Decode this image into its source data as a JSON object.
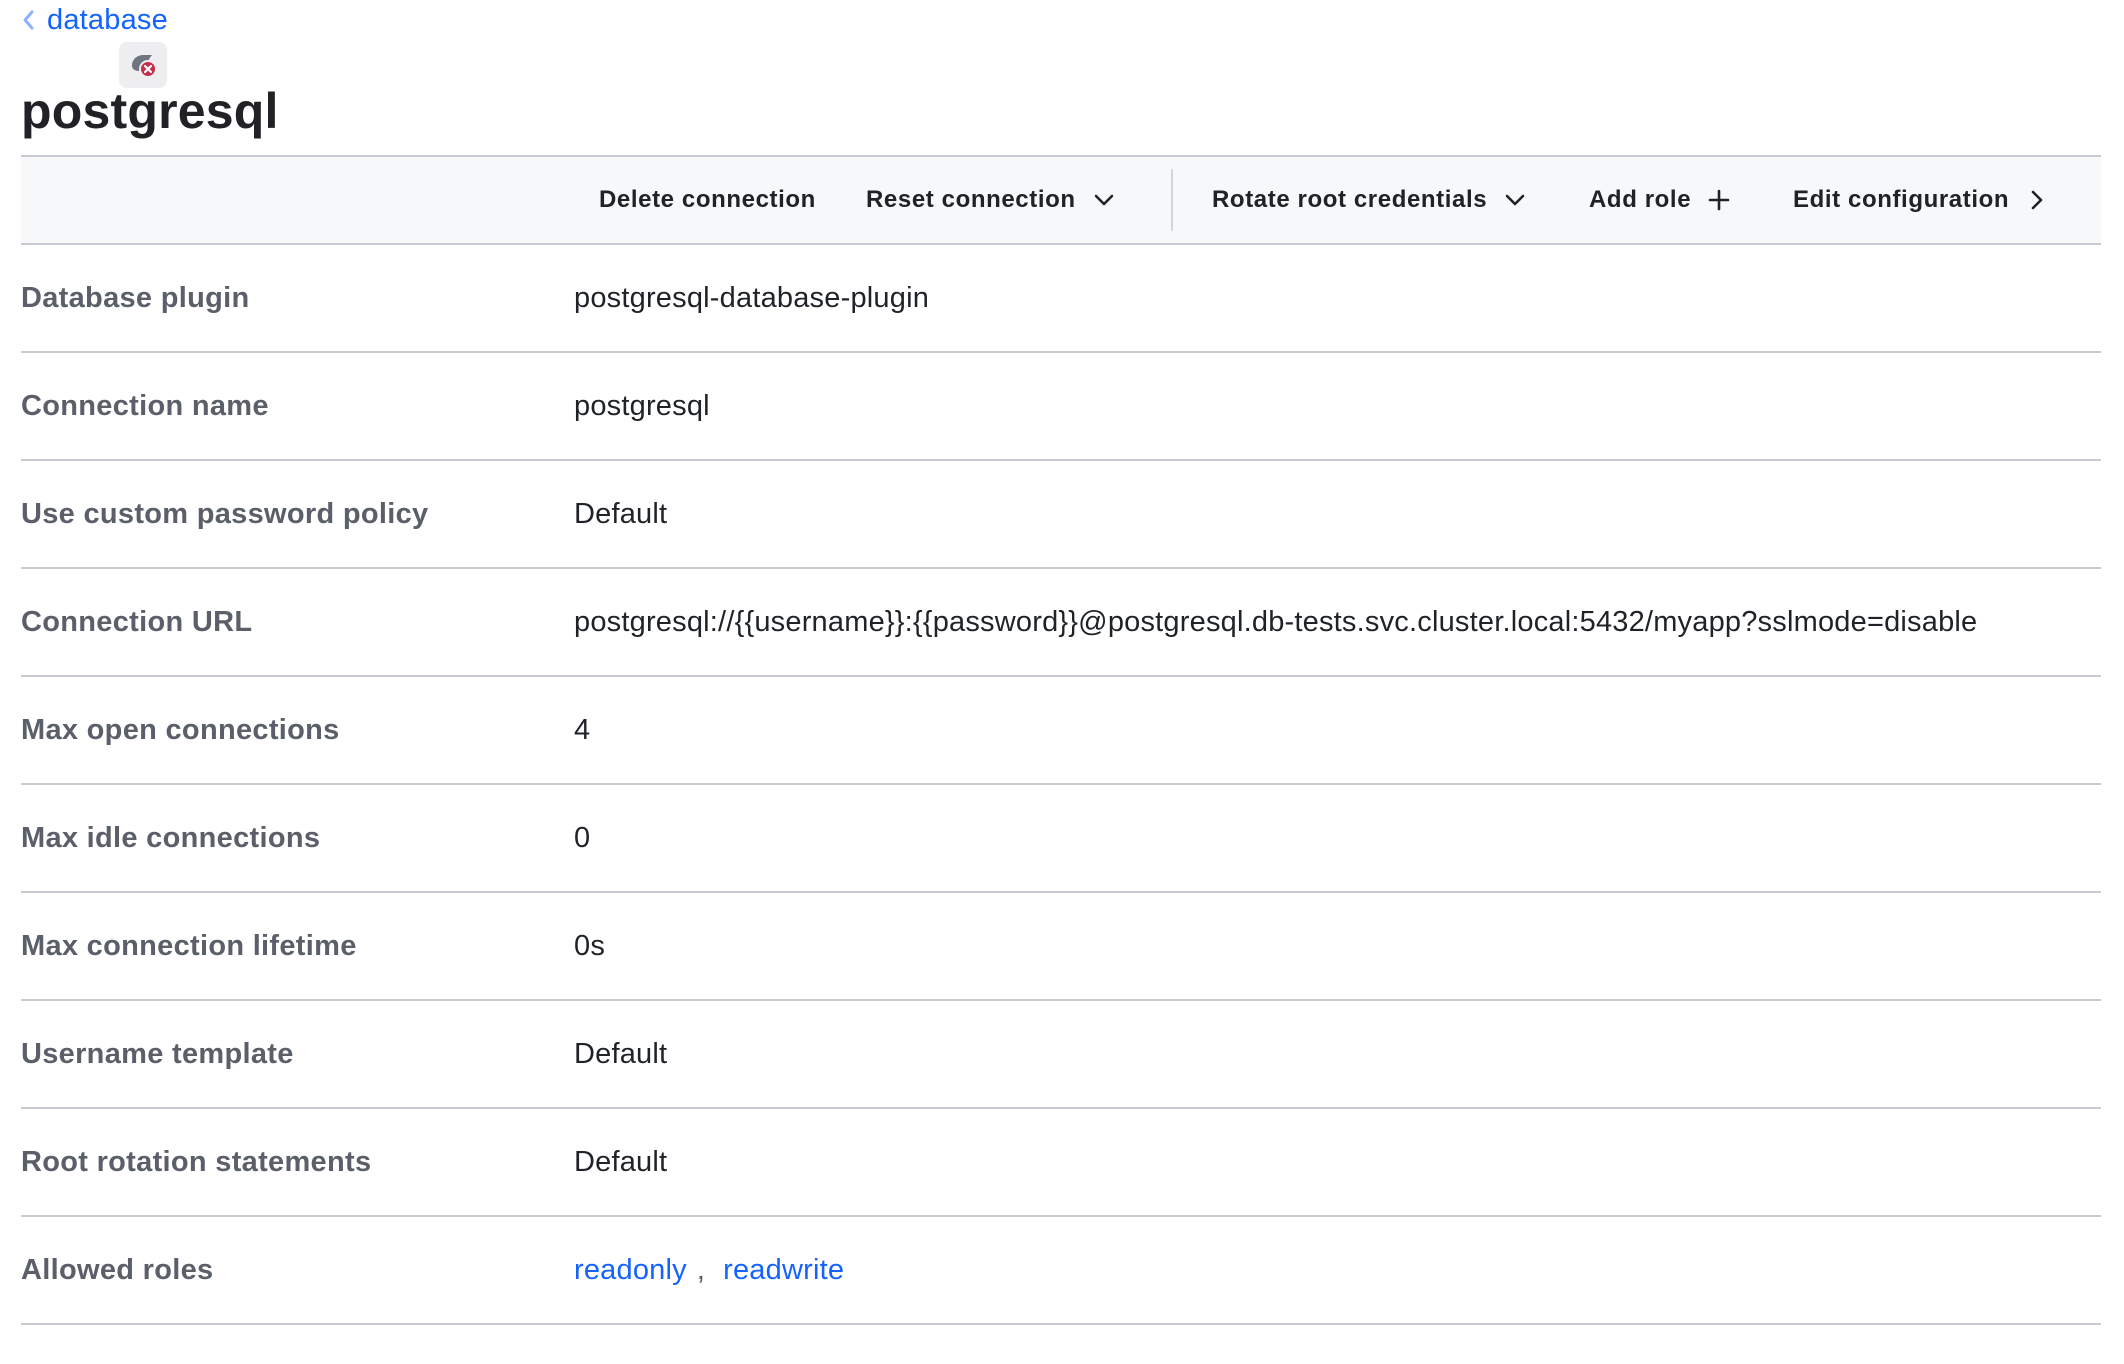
{
  "breadcrumb": {
    "label": "database",
    "icon": "chevron-left-icon"
  },
  "header": {
    "status_icon": "database-error-icon",
    "title": "postgresql"
  },
  "toolbar": {
    "delete_label": "Delete connection",
    "reset_label": "Reset connection",
    "rotate_label": "Rotate root credentials",
    "add_role_label": "Add role",
    "edit_label": "Edit configuration"
  },
  "details": [
    {
      "label": "Database plugin",
      "value": "postgresql-database-plugin"
    },
    {
      "label": "Connection name",
      "value": "postgresql"
    },
    {
      "label": "Use custom password policy",
      "value": "Default"
    },
    {
      "label": "Connection URL",
      "value": "postgresql://{{username}}:{{password}}@postgresql.db-tests.svc.cluster.local:5432/myapp?sslmode=disable"
    },
    {
      "label": "Max open connections",
      "value": "4"
    },
    {
      "label": "Max idle connections",
      "value": "0"
    },
    {
      "label": "Max connection lifetime",
      "value": "0s"
    },
    {
      "label": "Username template",
      "value": "Default"
    },
    {
      "label": "Root rotation statements",
      "value": "Default"
    }
  ],
  "allowed_roles": {
    "label": "Allowed roles",
    "roles": [
      "readonly",
      "readwrite"
    ],
    "separator": ","
  },
  "colors": {
    "link": "#1563ff",
    "error": "#c72e49",
    "border": "#c9cbd3",
    "toolbar_bg": "#f7f8fa"
  }
}
